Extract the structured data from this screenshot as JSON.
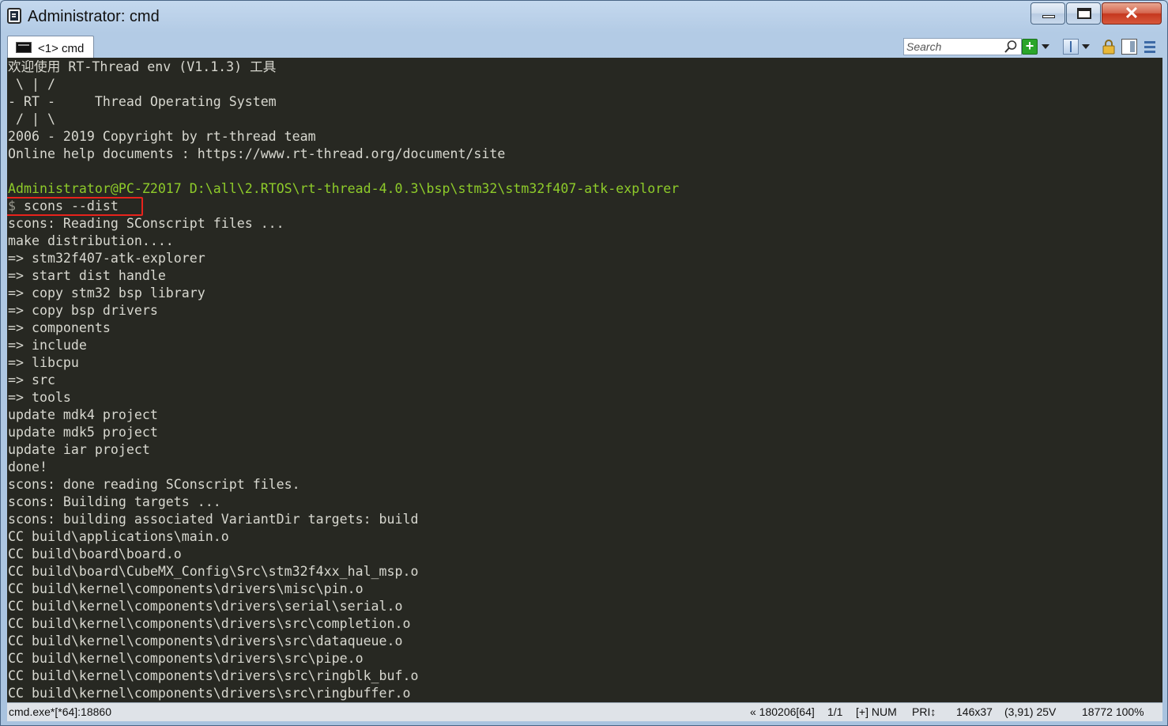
{
  "window": {
    "title": "Administrator: cmd"
  },
  "tab": {
    "label": "<1> cmd"
  },
  "toolbar": {
    "search_placeholder": "Search"
  },
  "terminal": {
    "banner": [
      "欢迎使用 RT-Thread env (V1.1.3) 工具",
      " \\ | /",
      "- RT -     Thread Operating System",
      " / | \\",
      "2006 - 2019 Copyright by rt-thread team",
      "Online help documents : https://www.rt-thread.org/document/site",
      ""
    ],
    "prompt_user": "Administrator@PC-Z2017",
    "prompt_path": "D:\\all\\2.RTOS\\rt-thread-4.0.3\\bsp\\stm32\\stm32f407-atk-explorer",
    "prompt_symbol": "$",
    "command": "scons --dist",
    "output": [
      "scons: Reading SConscript files ...",
      "make distribution....",
      "=> stm32f407-atk-explorer",
      "=> start dist handle",
      "=> copy stm32 bsp library",
      "=> copy bsp drivers",
      "=> components",
      "=> include",
      "=> libcpu",
      "=> src",
      "=> tools",
      "update mdk4 project",
      "update mdk5 project",
      "update iar project",
      "done!",
      "scons: done reading SConscript files.",
      "scons: Building targets ...",
      "scons: building associated VariantDir targets: build",
      "CC build\\applications\\main.o",
      "CC build\\board\\board.o",
      "CC build\\board\\CubeMX_Config\\Src\\stm32f4xx_hal_msp.o",
      "CC build\\kernel\\components\\drivers\\misc\\pin.o",
      "CC build\\kernel\\components\\drivers\\serial\\serial.o",
      "CC build\\kernel\\components\\drivers\\src\\completion.o",
      "CC build\\kernel\\components\\drivers\\src\\dataqueue.o",
      "CC build\\kernel\\components\\drivers\\src\\pipe.o",
      "CC build\\kernel\\components\\drivers\\src\\ringblk_buf.o",
      "CC build\\kernel\\components\\drivers\\src\\ringbuffer.o"
    ]
  },
  "statusbar": {
    "process": "cmd.exe*[*64]:18860",
    "buffer": "« 180206[64]",
    "page": "1/1",
    "mode": "[+] NUM",
    "priority": "PRI↕",
    "size": "146x37",
    "cursor": "(3,91) 25V",
    "memory": "18772 100%"
  },
  "colors": {
    "terminal_bg": "#272822",
    "terminal_fg": "#d8d8d0",
    "prompt_green": "#8ecb2a",
    "highlight_red": "#e8231c"
  }
}
